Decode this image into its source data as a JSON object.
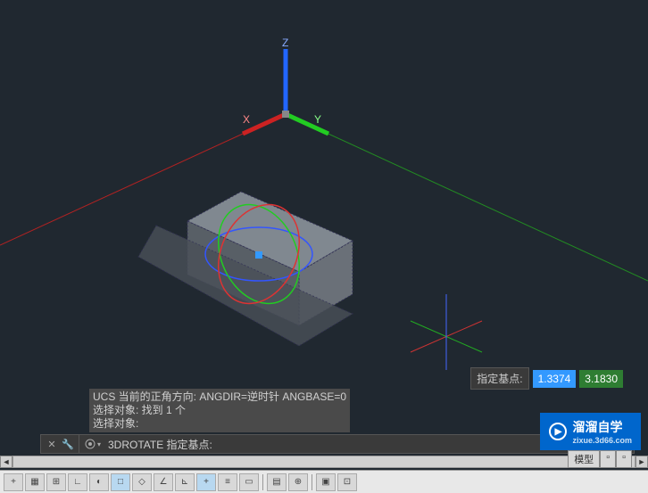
{
  "viewport": {
    "axes": {
      "x_label": "X",
      "y_label": "Y",
      "z_label": "Z"
    }
  },
  "tooltip": {
    "label": "指定基点:",
    "val1": "1.3374",
    "val2": "3.1830"
  },
  "cmd_history": {
    "line1": "UCS 当前的正角方向:  ANGDIR=逆时针  ANGBASE=0",
    "line2": "选择对象: 找到 1 个",
    "line3": "选择对象:"
  },
  "cmd_bar": {
    "prompt": "3DROTATE 指定基点:"
  },
  "tabs": {
    "model": "模型"
  },
  "watermark": {
    "brand": "溜溜自学",
    "url": "zixue.3d66.com"
  }
}
